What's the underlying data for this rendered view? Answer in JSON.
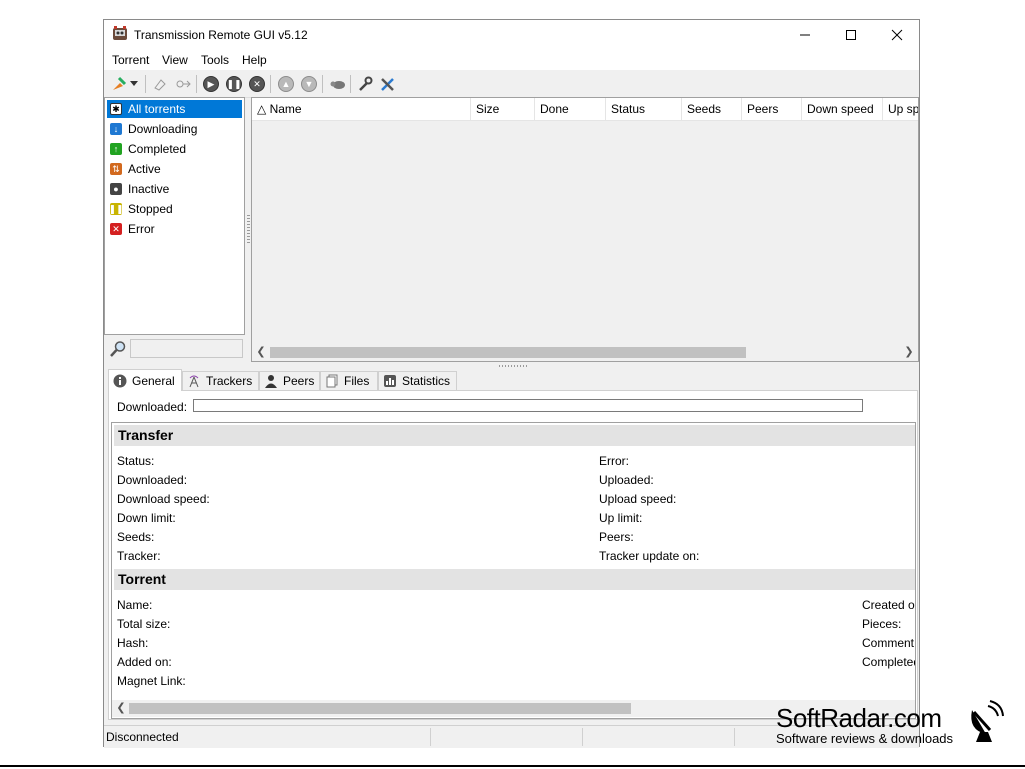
{
  "window": {
    "title": "Transmission Remote GUI v5.12",
    "minimize_icon": "minimize-icon",
    "maximize_icon": "maximize-icon",
    "close_icon": "close-icon"
  },
  "menu": {
    "items": [
      "Torrent",
      "View",
      "Tools",
      "Help"
    ]
  },
  "toolbar": {
    "icons": [
      "add-torrent-icon",
      "dropdown-icon",
      "add-link-icon",
      "move-icon",
      "start-icon",
      "pause-icon",
      "stop-icon",
      "move-up-icon",
      "move-down-icon",
      "speed-limit-icon",
      "options-icon",
      "connection-settings-icon"
    ]
  },
  "filters": {
    "items": [
      {
        "label": "All torrents",
        "color": "#ffffff",
        "selected": true
      },
      {
        "label": "Downloading",
        "color": "#1e78d2"
      },
      {
        "label": "Completed",
        "color": "#21a321"
      },
      {
        "label": "Active",
        "color": "#d2691e"
      },
      {
        "label": "Inactive",
        "color": "#444444"
      },
      {
        "label": "Stopped",
        "color": "#c8b400"
      },
      {
        "label": "Error",
        "color": "#d42020"
      }
    ],
    "search_placeholder": ""
  },
  "torrent_list": {
    "columns": [
      "△ Name",
      "Size",
      "Done",
      "Status",
      "Seeds",
      "Peers",
      "Down speed",
      "Up spe"
    ]
  },
  "tabs": [
    {
      "label": "General",
      "icon": "info-icon",
      "active": true
    },
    {
      "label": "Trackers",
      "icon": "tracker-icon"
    },
    {
      "label": "Peers",
      "icon": "peers-icon"
    },
    {
      "label": "Files",
      "icon": "files-icon"
    },
    {
      "label": "Statistics",
      "icon": "statistics-icon"
    }
  ],
  "general": {
    "downloaded_label": "Downloaded:",
    "transfer": {
      "heading": "Transfer",
      "left": [
        "Status:",
        "Downloaded:",
        "Download speed:",
        "Down limit:",
        "Seeds:",
        "Tracker:"
      ],
      "right": [
        "Error:",
        "Uploaded:",
        "Upload speed:",
        "Up limit:",
        "Peers:",
        "Tracker update on:"
      ]
    },
    "torrent": {
      "heading": "Torrent",
      "left": [
        "Name:",
        "Total size:",
        "Hash:",
        "Added on:",
        "Magnet Link:"
      ],
      "right": [
        "Created or",
        "Pieces:",
        "Comment:",
        "Completed"
      ]
    }
  },
  "statusbar": {
    "connection": "Disconnected"
  },
  "watermark": {
    "title": "SoftRadar.com",
    "subtitle": "Software reviews & downloads"
  }
}
